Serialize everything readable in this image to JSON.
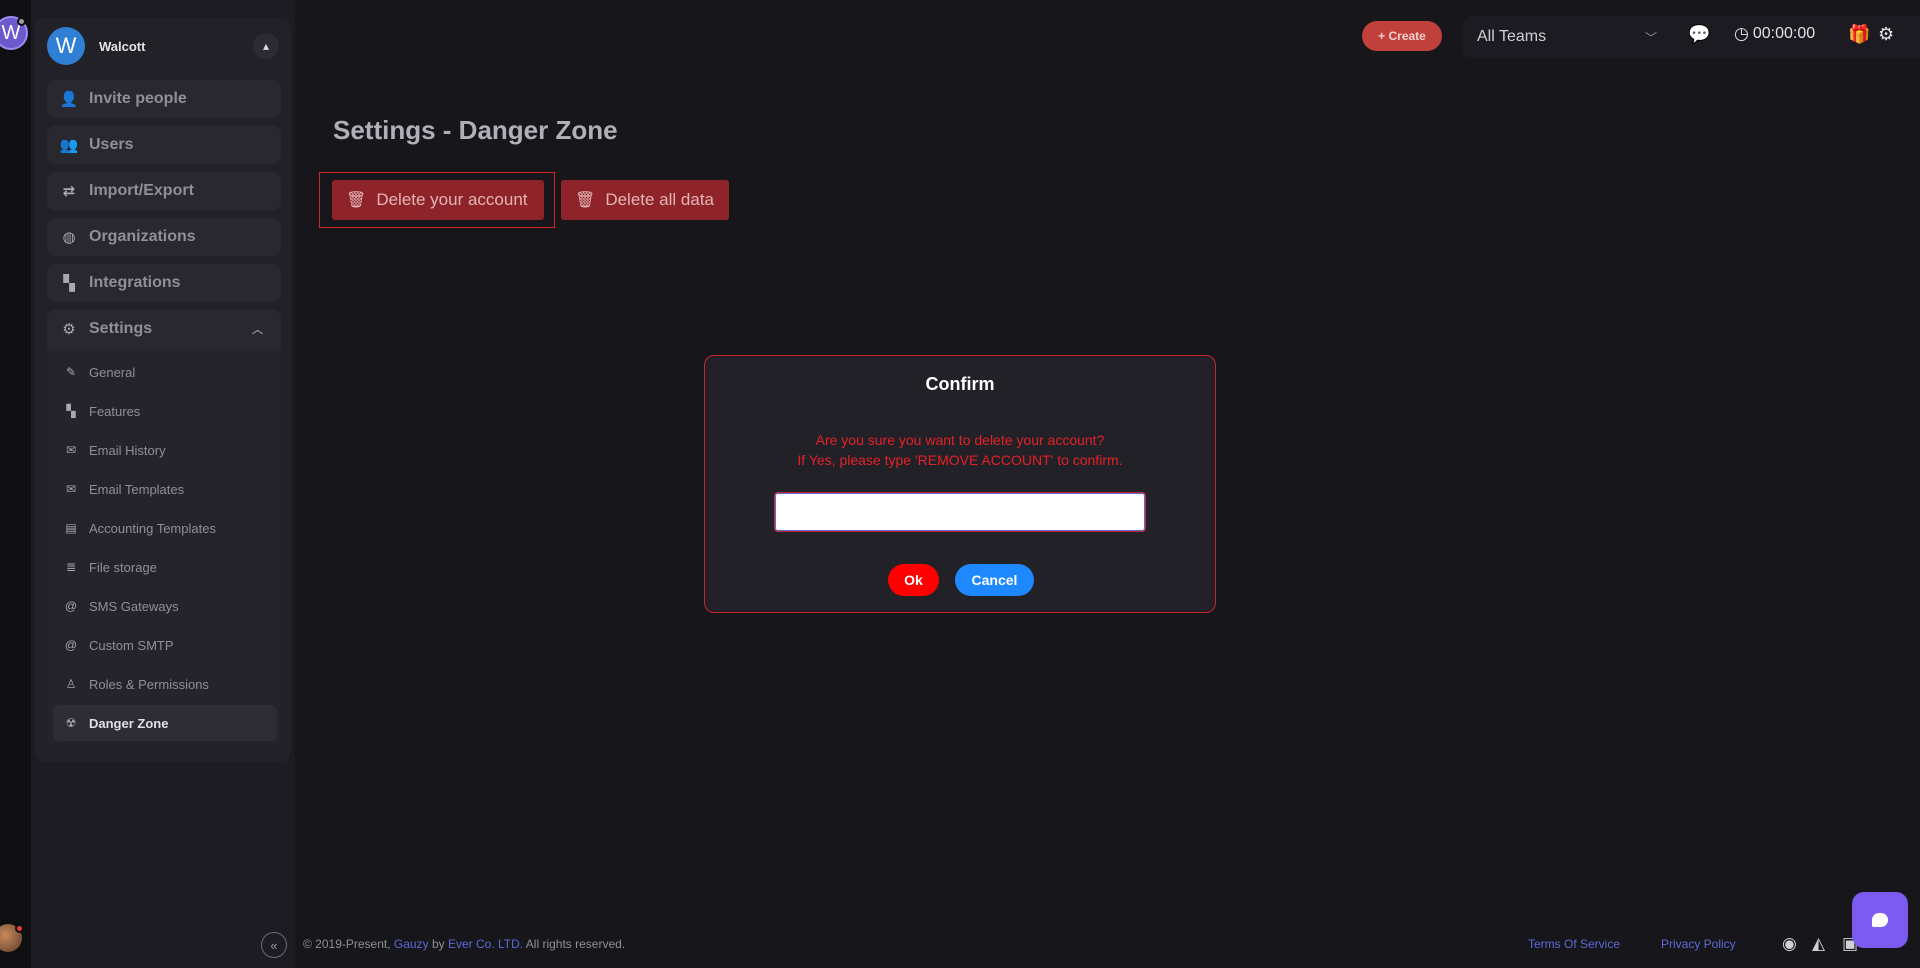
{
  "user": {
    "name": "Walcott",
    "initial": "W"
  },
  "sidebar": {
    "items": [
      {
        "label": "Invite people",
        "icon": "user-plus-icon"
      },
      {
        "label": "Users",
        "icon": "users-icon"
      },
      {
        "label": "Import/Export",
        "icon": "swap-icon"
      },
      {
        "label": "Organizations",
        "icon": "globe-icon"
      },
      {
        "label": "Integrations",
        "icon": "puzzle-icon"
      },
      {
        "label": "Settings",
        "icon": "gear-icon"
      }
    ],
    "settings_sub": [
      {
        "label": "General",
        "icon": "pencil-icon"
      },
      {
        "label": "Features",
        "icon": "puzzle-icon"
      },
      {
        "label": "Email History",
        "icon": "envelope-open-icon"
      },
      {
        "label": "Email Templates",
        "icon": "envelope-icon"
      },
      {
        "label": "Accounting Templates",
        "icon": "id-card-icon"
      },
      {
        "label": "File storage",
        "icon": "database-icon"
      },
      {
        "label": "SMS Gateways",
        "icon": "at-icon"
      },
      {
        "label": "Custom SMTP",
        "icon": "at-icon"
      },
      {
        "label": "Roles & Permissions",
        "icon": "award-icon"
      },
      {
        "label": "Danger Zone",
        "icon": "radiation-icon"
      }
    ]
  },
  "header": {
    "create_label": "+ Create",
    "team_select": "All Teams",
    "timer": "00:00:00"
  },
  "page": {
    "title": "Settings - Danger Zone",
    "delete_account_label": "Delete your account",
    "delete_data_label": "Delete all data"
  },
  "modal": {
    "title": "Confirm",
    "line1": "Are you sure you want to delete your account?",
    "line2": "If Yes, please type 'REMOVE ACCOUNT' to confirm.",
    "input_value": "",
    "ok_label": "Ok",
    "cancel_label": "Cancel"
  },
  "footer": {
    "copyright_prefix": "© 2019-Present,",
    "brand": "Gauzy",
    "by": "by",
    "company": "Ever Co. LTD.",
    "rights": "All rights reserved.",
    "terms": "Terms Of Service",
    "privacy": "Privacy Policy"
  },
  "colors": {
    "accent_danger": "#8e232a",
    "ok_button": "#ff0000",
    "cancel_button": "#1e88ff",
    "create_button": "#c0413b",
    "modal_text": "#e52127"
  }
}
